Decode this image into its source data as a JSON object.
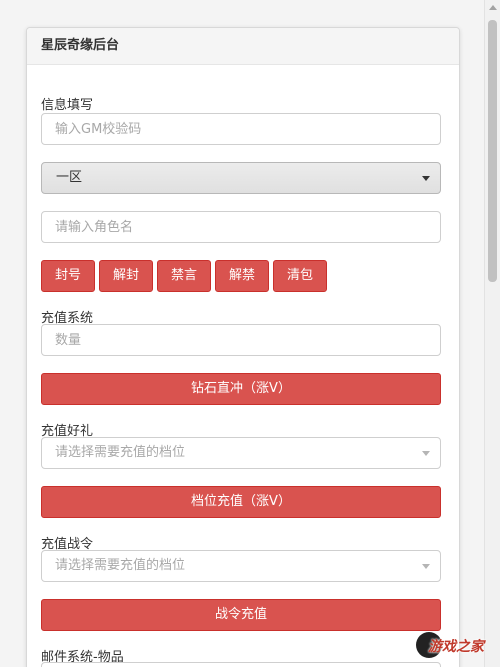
{
  "panel": {
    "title": "星辰奇缘后台"
  },
  "info": {
    "label": "信息填写",
    "gm_code_placeholder": "输入GM校验码",
    "server_select_value": "一区",
    "role_name_placeholder": "请输入角色名"
  },
  "actions": {
    "ban": "封号",
    "unban": "解封",
    "mute": "禁言",
    "unmute": "解禁",
    "clear_bag": "清包"
  },
  "recharge": {
    "label": "充值系统",
    "amount_placeholder": "数量",
    "diamond_button": "钻石直冲（涨V）"
  },
  "gift": {
    "label": "充值好礼",
    "select_placeholder": "请选择需要充值的档位",
    "button": "档位充值（涨V）"
  },
  "battlepass": {
    "label": "充值战令",
    "select_placeholder": "请选择需要充值的档位",
    "button": "战令充值"
  },
  "mail": {
    "label": "邮件系统-物品"
  },
  "watermark": {
    "text": "游戏之家"
  },
  "colors": {
    "danger": "#d9534f",
    "danger_border": "#c9302c"
  }
}
